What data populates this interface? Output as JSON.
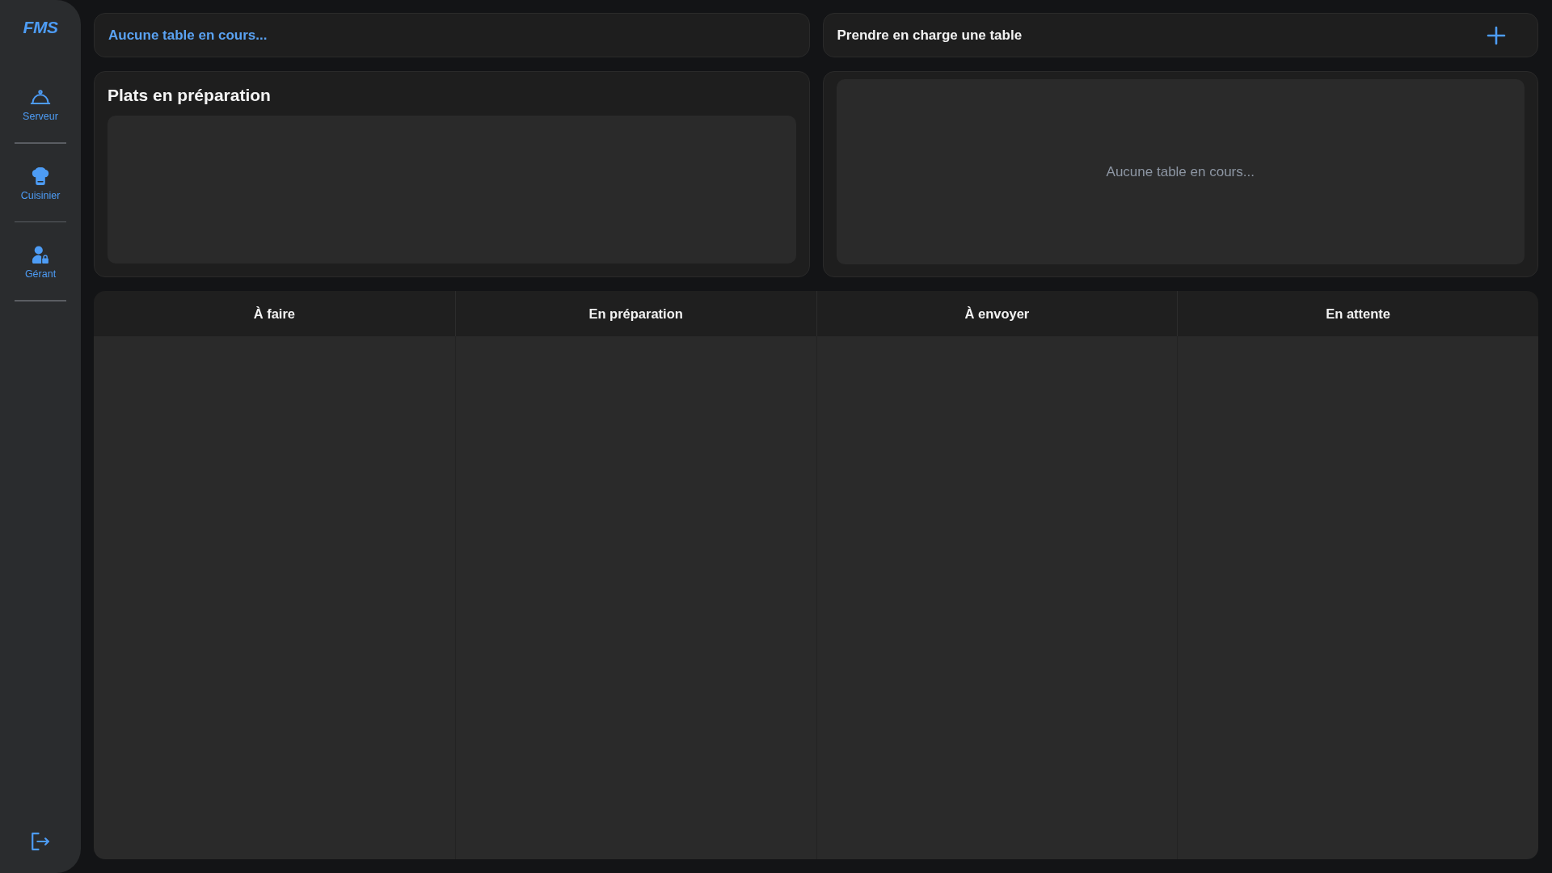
{
  "sidebar": {
    "logo": "FMS",
    "items": [
      {
        "label": "Serveur",
        "kind": "cloche"
      },
      {
        "label": "Cuisinier",
        "kind": "chef"
      },
      {
        "label": "Gérant",
        "kind": "manager"
      }
    ]
  },
  "current_table": {
    "text": "Aucune table en cours..."
  },
  "take_table": {
    "label": "Prendre en charge une table"
  },
  "dishes_panel": {
    "title": "Plats en préparation"
  },
  "tables_panel": {
    "empty_text": "Aucune table en cours..."
  },
  "board": {
    "columns": [
      {
        "title": "À faire"
      },
      {
        "title": "En préparation"
      },
      {
        "title": "À envoyer"
      },
      {
        "title": "En attente"
      }
    ]
  }
}
